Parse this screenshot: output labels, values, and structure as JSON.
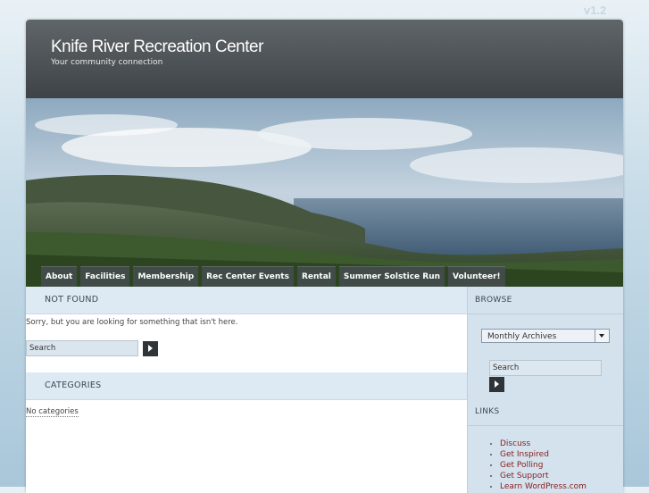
{
  "version": "v1.2",
  "site": {
    "title": "Knife River Recreation Center",
    "tagline": "Your community connection"
  },
  "nav": [
    {
      "label": "About"
    },
    {
      "label": "Facilities"
    },
    {
      "label": "Membership"
    },
    {
      "label": "Rec Center Events"
    },
    {
      "label": "Rental"
    },
    {
      "label": "Summer Solstice Run"
    },
    {
      "label": "Volunteer!"
    }
  ],
  "main": {
    "not_found_heading": "NOT FOUND",
    "not_found_message": "Sorry, but you are looking for something that isn't here.",
    "search_value": "Search",
    "categories_heading": "CATEGORIES",
    "no_categories": "No categories"
  },
  "sidebar": {
    "browse_heading": "BROWSE",
    "archives_select": "Monthly Archives",
    "search_value": "Search",
    "links_heading": "LINKS",
    "links": [
      {
        "label": "Discuss"
      },
      {
        "label": "Get Inspired"
      },
      {
        "label": "Get Polling"
      },
      {
        "label": "Get Support"
      },
      {
        "label": "Learn WordPress.com"
      }
    ]
  },
  "colors": {
    "header_bg": "#4a4f53",
    "section_head_bg": "#dde9f3",
    "sidebar_bg": "#d3e2ed",
    "link_color": "#8a2020"
  }
}
